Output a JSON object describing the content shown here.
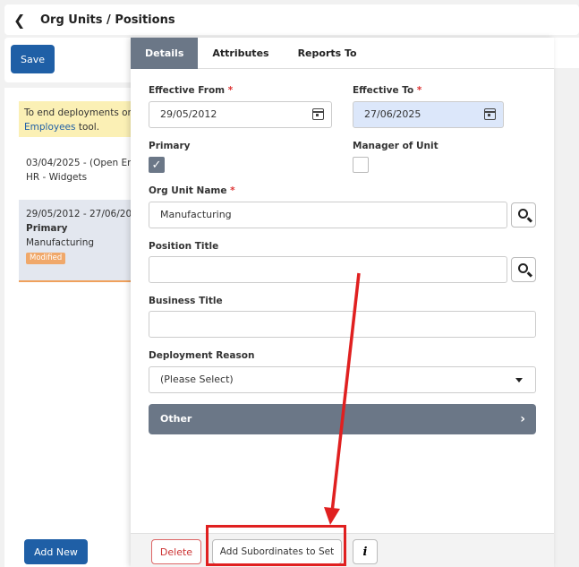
{
  "header": {
    "title": "Org Units / Positions"
  },
  "toolbar": {
    "save_label": "Save"
  },
  "left_panel": {
    "notice_text": "To end deployments or r",
    "notice_link": "Employees",
    "notice_suffix": " tool.",
    "deployments": [
      {
        "date_range": "03/04/2025 - (Open End",
        "line2": "HR - Widgets"
      },
      {
        "date_range": "29/05/2012 - 27/06/202",
        "line2": "Primary",
        "line3": "Manufacturing",
        "badge": "Modified"
      }
    ],
    "add_new_label": "Add New"
  },
  "tabs": [
    {
      "label": "Details"
    },
    {
      "label": "Attributes"
    },
    {
      "label": "Reports To"
    }
  ],
  "form": {
    "effective_from_label": "Effective From",
    "effective_from_value": "29/05/2012",
    "effective_to_label": "Effective To",
    "effective_to_value": "27/06/2025",
    "primary_label": "Primary",
    "primary_checked": true,
    "manager_label": "Manager of Unit",
    "manager_checked": false,
    "org_unit_label": "Org Unit Name",
    "org_unit_value": "Manufacturing",
    "position_title_label": "Position Title",
    "position_title_value": "",
    "business_title_label": "Business Title",
    "business_title_value": "",
    "deployment_reason_label": "Deployment Reason",
    "deployment_reason_value": "(Please Select)",
    "other_label": "Other",
    "required_mark": "*"
  },
  "footer": {
    "delete_label": "Delete",
    "add_subordinates_label": "Add Subordinates to Set",
    "info_label": "i"
  },
  "colors": {
    "accent": "#1f5fa6",
    "tab_active": "#6b7787",
    "highlight": "#e02020"
  }
}
